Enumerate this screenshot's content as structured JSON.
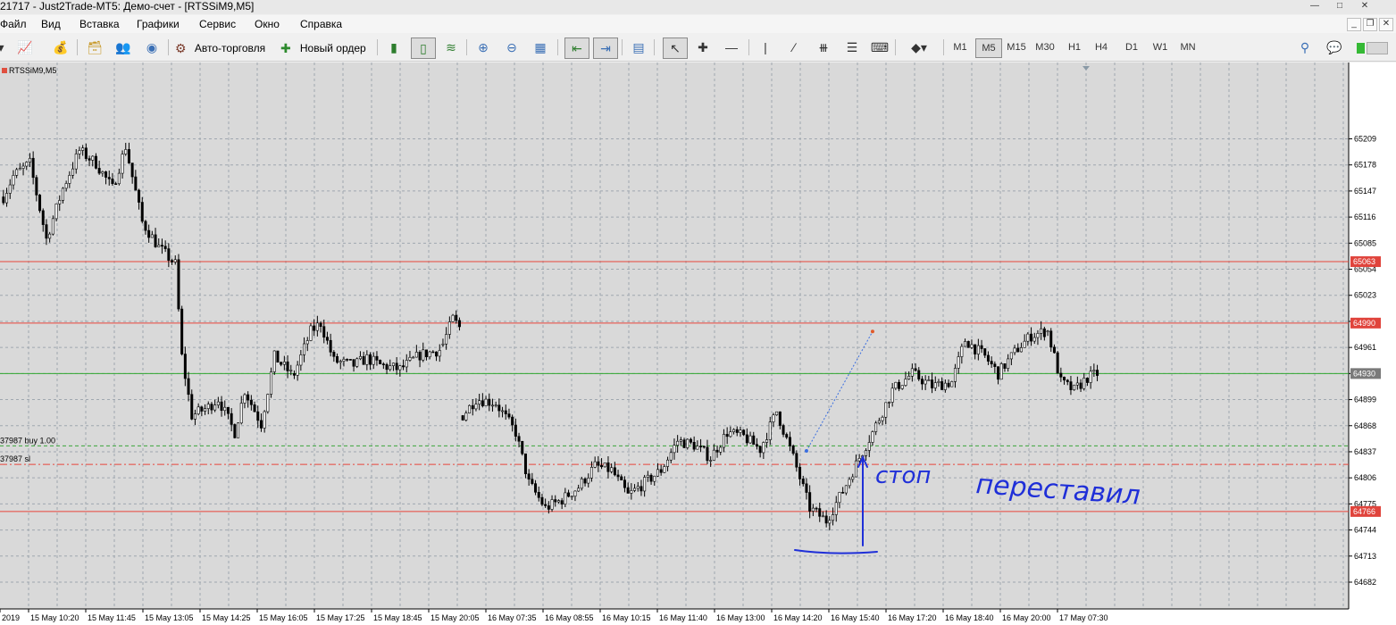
{
  "window": {
    "title": "21717 - Just2Trade-MT5: Демо-счет - [RTSSiM9,M5]"
  },
  "menu": {
    "items": [
      "Файл",
      "Вид",
      "Вставка",
      "Графики",
      "Сервис",
      "Окно",
      "Справка"
    ]
  },
  "toolbar": {
    "autotrade_label": "Авто-торговля",
    "new_order_label": "Новый ордер",
    "timeframes": [
      "M1",
      "M5",
      "M15",
      "M30",
      "H1",
      "H4",
      "D1",
      "W1",
      "MN"
    ],
    "selected_timeframe": "M5"
  },
  "chart": {
    "symbol_label": "RTSSiM9,M5",
    "bar_interval_minutes": 5,
    "background": "#d9d9d9",
    "grid_color": "#a0a8b0",
    "candle_color": "#000000",
    "price_ticks": [
      65209,
      65178,
      65147,
      65116,
      65085,
      65054,
      65023,
      64992,
      64961,
      64930,
      64899,
      64868,
      64837,
      64806,
      64775,
      64744,
      64713,
      64682
    ],
    "time_labels": [
      "2019",
      "15 May 10:20",
      "15 May 11:45",
      "15 May 13:05",
      "15 May 14:25",
      "15 May 16:05",
      "15 May 17:25",
      "15 May 18:45",
      "15 May 20:05",
      "16 May 07:35",
      "16 May 08:55",
      "16 May 10:15",
      "16 May 11:40",
      "16 May 13:00",
      "16 May 14:20",
      "16 May 15:40",
      "16 May 17:20",
      "16 May 18:40",
      "16 May 20:00",
      "17 May 07:30"
    ],
    "hlines": [
      {
        "price": 65063,
        "color": "#e8463c",
        "badge": "65063",
        "badge_color": "#e0443c"
      },
      {
        "price": 64990,
        "color": "#e8463c",
        "badge": "64990",
        "badge_color": "#e0443c"
      },
      {
        "price": 64930,
        "color": "#2fa82f",
        "badge": "64930",
        "badge_color": "#7a7a7a"
      },
      {
        "price": 64766,
        "color": "#e8463c",
        "badge": "64766",
        "badge_color": "#e0443c"
      }
    ],
    "order_lines": [
      {
        "label": "37987 buy 1.00",
        "price": 64844,
        "color": "#3aa63a",
        "style": "dashed"
      },
      {
        "label": "37987 sl",
        "price": 64822,
        "color": "#e8463c",
        "style": "dashdot"
      }
    ],
    "trade_line": {
      "from_time": "16 May 15:40",
      "from_price": 64838,
      "to_time": "16 May 17:20",
      "to_price": 64980,
      "color": "#3b6fe0"
    },
    "annotations": {
      "color": "#1f2fd8",
      "word1": "стоп",
      "word2": "переставил"
    }
  },
  "chart_data": {
    "type": "candlestick",
    "title": "RTSSiM9,M5",
    "ylim": [
      64682,
      65225
    ],
    "segments": [
      {
        "start": "15 May 09:25",
        "bars": 88,
        "anchors": [
          [
            0,
            65140
          ],
          [
            3,
            65165
          ],
          [
            8,
            65180
          ],
          [
            13,
            65090
          ],
          [
            18,
            65150
          ],
          [
            23,
            65195
          ],
          [
            28,
            65180
          ],
          [
            33,
            65150
          ],
          [
            37,
            65200
          ],
          [
            42,
            65110
          ],
          [
            47,
            65080
          ],
          [
            52,
            65060
          ],
          [
            54,
            64950
          ],
          [
            57,
            64880
          ],
          [
            62,
            64890
          ],
          [
            65,
            64900
          ],
          [
            70,
            64860
          ],
          [
            73,
            64910
          ],
          [
            78,
            64870
          ],
          [
            82,
            64950
          ],
          [
            87,
            64930
          ]
        ]
      },
      {
        "start": "15 May 16:50",
        "bars": 45,
        "anchors": [
          [
            0,
            64930
          ],
          [
            5,
            64980
          ],
          [
            8,
            64990
          ],
          [
            12,
            64945
          ],
          [
            18,
            64940
          ],
          [
            22,
            64948
          ],
          [
            26,
            64940
          ],
          [
            32,
            64935
          ],
          [
            38,
            64952
          ],
          [
            44,
            64958
          ]
        ]
      },
      {
        "start": "15 May 20:35",
        "bars": 6,
        "anchors": [
          [
            0,
            64965
          ],
          [
            3,
            64995
          ],
          [
            5,
            64985
          ]
        ]
      },
      {
        "start": "16 May 07:00",
        "bars": 177,
        "anchors": [
          [
            0,
            64880
          ],
          [
            4,
            64900
          ],
          [
            10,
            64895
          ],
          [
            16,
            64860
          ],
          [
            20,
            64800
          ],
          [
            25,
            64770
          ],
          [
            30,
            64780
          ],
          [
            35,
            64795
          ],
          [
            40,
            64820
          ],
          [
            45,
            64815
          ],
          [
            50,
            64785
          ],
          [
            55,
            64800
          ],
          [
            60,
            64815
          ],
          [
            65,
            64850
          ],
          [
            70,
            64845
          ],
          [
            75,
            64830
          ],
          [
            80,
            64860
          ],
          [
            85,
            64855
          ],
          [
            90,
            64840
          ],
          [
            95,
            64885
          ],
          [
            100,
            64830
          ],
          [
            105,
            64770
          ],
          [
            110,
            64755
          ],
          [
            115,
            64790
          ],
          [
            120,
            64830
          ],
          [
            124,
            64860
          ],
          [
            130,
            64910
          ],
          [
            136,
            64930
          ],
          [
            142,
            64915
          ],
          [
            148,
            64920
          ],
          [
            152,
            64970
          ],
          [
            158,
            64950
          ],
          [
            162,
            64930
          ],
          [
            168,
            64960
          ],
          [
            172,
            64975
          ],
          [
            176,
            64980
          ]
        ]
      },
      {
        "start": "16 May 21:50",
        "bars": 16,
        "anchors": [
          [
            0,
            64980
          ],
          [
            4,
            64920
          ],
          [
            8,
            64910
          ],
          [
            12,
            64925
          ],
          [
            15,
            64930
          ]
        ]
      }
    ]
  }
}
